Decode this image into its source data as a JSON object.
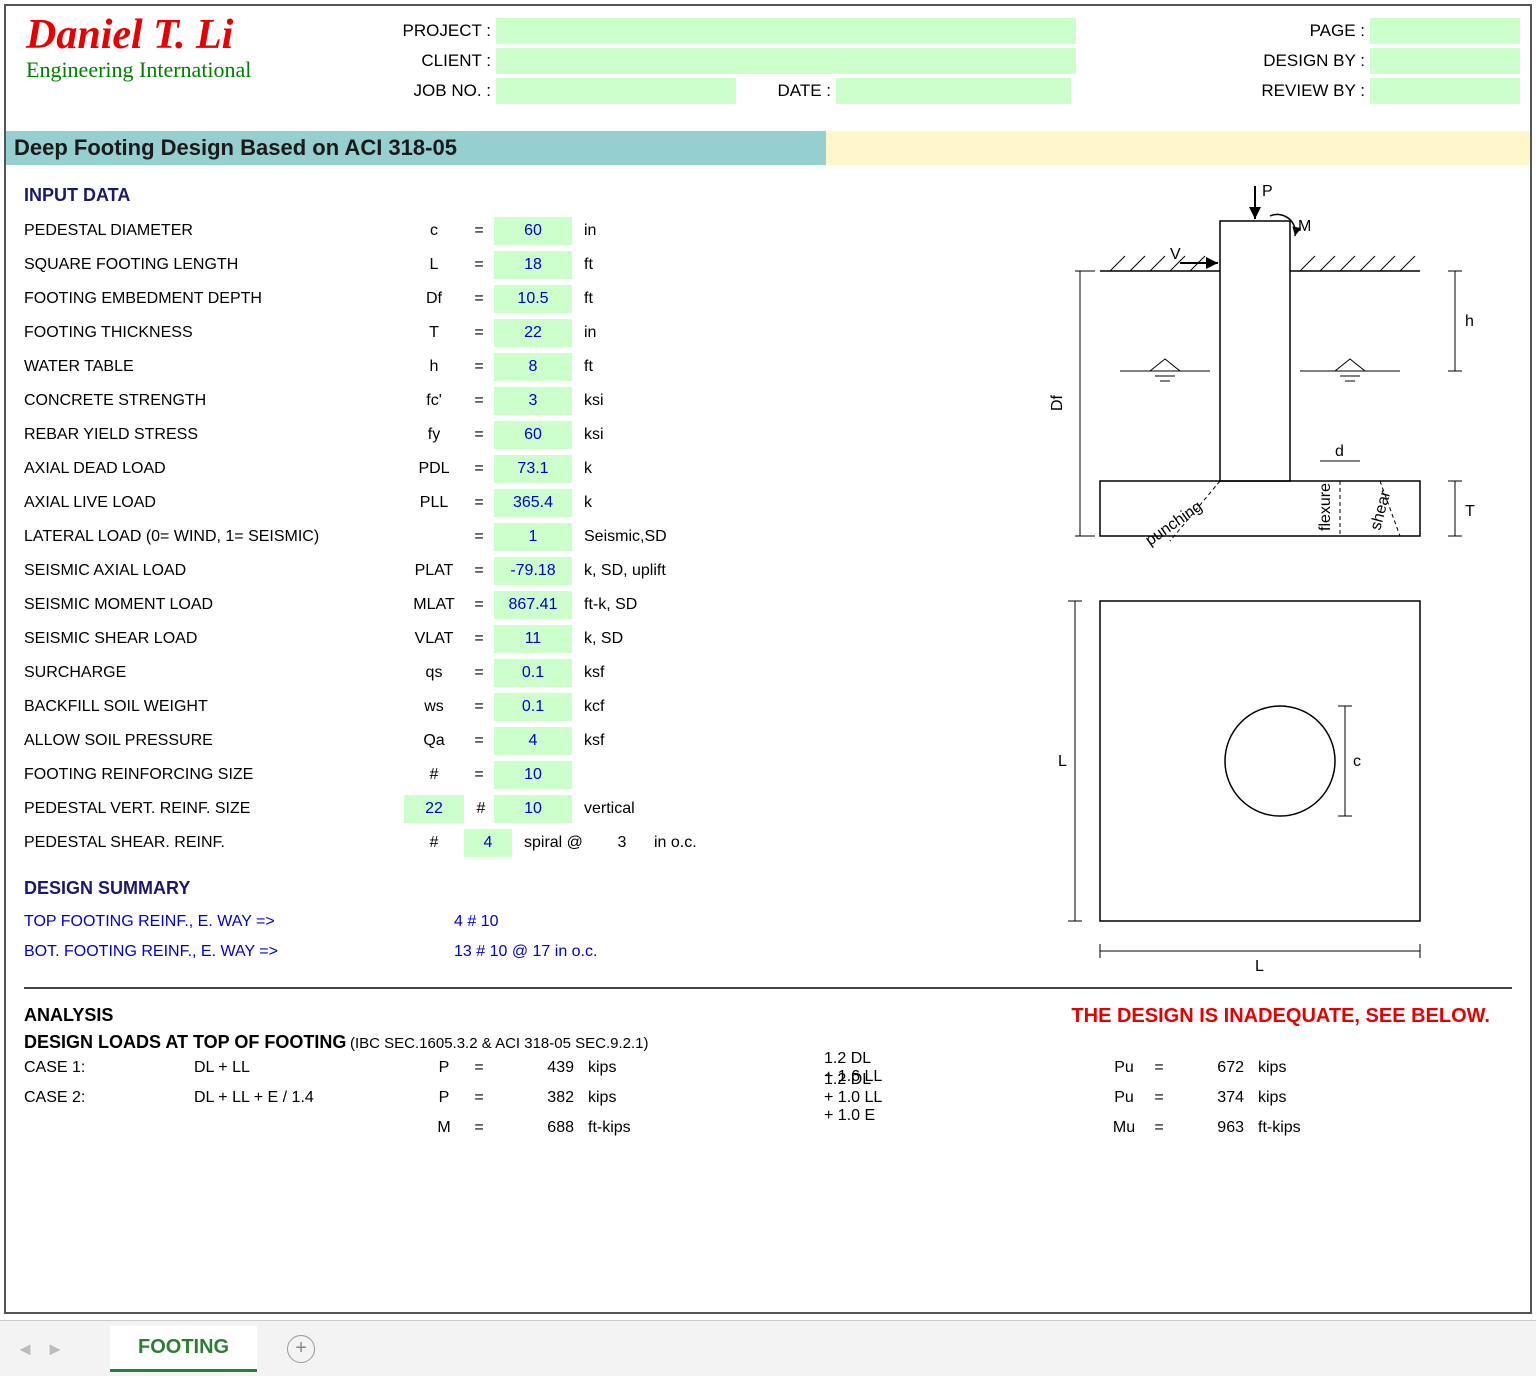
{
  "logo": {
    "name": "Daniel T. Li",
    "sub": "Engineering International"
  },
  "header": {
    "project_lab": "PROJECT :",
    "client_lab": "CLIENT :",
    "jobno_lab": "JOB NO. :",
    "date_lab": "DATE :",
    "page_lab": "PAGE :",
    "design_lab": "DESIGN BY :",
    "review_lab": "REVIEW BY :"
  },
  "title": "Deep Footing Design Based on ACI 318-05",
  "input": {
    "heading": "INPUT DATA",
    "rows": [
      {
        "lab": "PEDESTAL DIAMETER",
        "sym": "c",
        "val": "60",
        "unit": "in"
      },
      {
        "lab": "SQUARE FOOTING LENGTH",
        "sym": "L",
        "val": "18",
        "unit": "ft"
      },
      {
        "lab": "FOOTING EMBEDMENT DEPTH",
        "sym": "Df",
        "val": "10.5",
        "unit": "ft"
      },
      {
        "lab": "FOOTING THICKNESS",
        "sym": "T",
        "val": "22",
        "unit": "in"
      },
      {
        "lab": "WATER TABLE",
        "sym": "h",
        "val": "8",
        "unit": "ft"
      },
      {
        "lab": "CONCRETE STRENGTH",
        "sym": "fc'",
        "val": "3",
        "unit": "ksi"
      },
      {
        "lab": "REBAR YIELD STRESS",
        "sym": "fy",
        "val": "60",
        "unit": "ksi"
      },
      {
        "lab": "AXIAL DEAD LOAD",
        "sym": "PDL",
        "val": "73.1",
        "unit": "k"
      },
      {
        "lab": "AXIAL LIVE LOAD",
        "sym": "PLL",
        "val": "365.4",
        "unit": "k"
      },
      {
        "lab": "LATERAL LOAD (0= WIND, 1= SEISMIC)",
        "sym": "",
        "val": "1",
        "unit": "Seismic,SD"
      },
      {
        "lab": "SEISMIC AXIAL LOAD",
        "sym": "PLAT",
        "val": "-79.18",
        "unit": "k, SD, uplift"
      },
      {
        "lab": "SEISMIC MOMENT LOAD",
        "sym": "MLAT",
        "val": "867.41",
        "unit": "ft-k, SD"
      },
      {
        "lab": "SEISMIC SHEAR LOAD",
        "sym": "VLAT",
        "val": "11",
        "unit": "k, SD"
      },
      {
        "lab": "SURCHARGE",
        "sym": "qs",
        "val": "0.1",
        "unit": "ksf"
      },
      {
        "lab": "BACKFILL SOIL WEIGHT",
        "sym": "ws",
        "val": "0.1",
        "unit": "kcf"
      },
      {
        "lab": "ALLOW SOIL PRESSURE",
        "sym": "Qa",
        "val": "4",
        "unit": "ksf"
      },
      {
        "lab": "FOOTING REINFORCING SIZE",
        "sym": "#",
        "val": "10",
        "unit": ""
      }
    ],
    "pedvert": {
      "lab": "PEDESTAL VERT. REINF. SIZE",
      "qty": "22",
      "sym": "#",
      "val": "10",
      "unit": "vertical"
    },
    "pedshear": {
      "lab": "PEDESTAL SHEAR. REINF.",
      "sym": "#",
      "val": "4",
      "unit1": "spiral @",
      "sp": "3",
      "unit2": "in o.c."
    }
  },
  "summary": {
    "heading": "DESIGN SUMMARY",
    "top": {
      "lab": "TOP FOOTING REINF., E. WAY =>",
      "val": "4 # 10"
    },
    "bot": {
      "lab": "BOT. FOOTING REINF., E. WAY =>",
      "val": "13 # 10 @ 17 in o.c."
    }
  },
  "warning": "THE DESIGN IS INADEQUATE, SEE BELOW.",
  "analysis": {
    "heading": "ANALYSIS",
    "sub": "DESIGN LOADS AT TOP OF FOOTING",
    "ref": "(IBC SEC.1605.3.2 & ACI 318-05 SEC.9.2.1)",
    "c1": {
      "name": "CASE 1:",
      "combo": "DL + LL",
      "P": "439",
      "Pu_combo": "1.2 DL + 1.6 LL",
      "Pu": "672"
    },
    "c2": {
      "name": "CASE 2:",
      "combo": "DL + LL + E / 1.4",
      "P": "382",
      "Pu_combo": "1.2 DL + 1.0 LL + 1.0 E",
      "Pu": "374"
    },
    "m": {
      "M": "688",
      "Mu": "963"
    },
    "kips": "kips",
    "ftkips": "ft-kips",
    "Plab": "P",
    "eqs": "=",
    "Pulab": "Pu",
    "Mlab": "M",
    "Mulab": "Mu"
  },
  "tab": "FOOTING",
  "diagram": {
    "P": "P",
    "M": "M",
    "V": "V",
    "Df": "Df",
    "h": "h",
    "d": "d",
    "T": "T",
    "L": "L",
    "c": "c",
    "punching": "punching",
    "flexure": "flexure",
    "shear": "shear"
  }
}
